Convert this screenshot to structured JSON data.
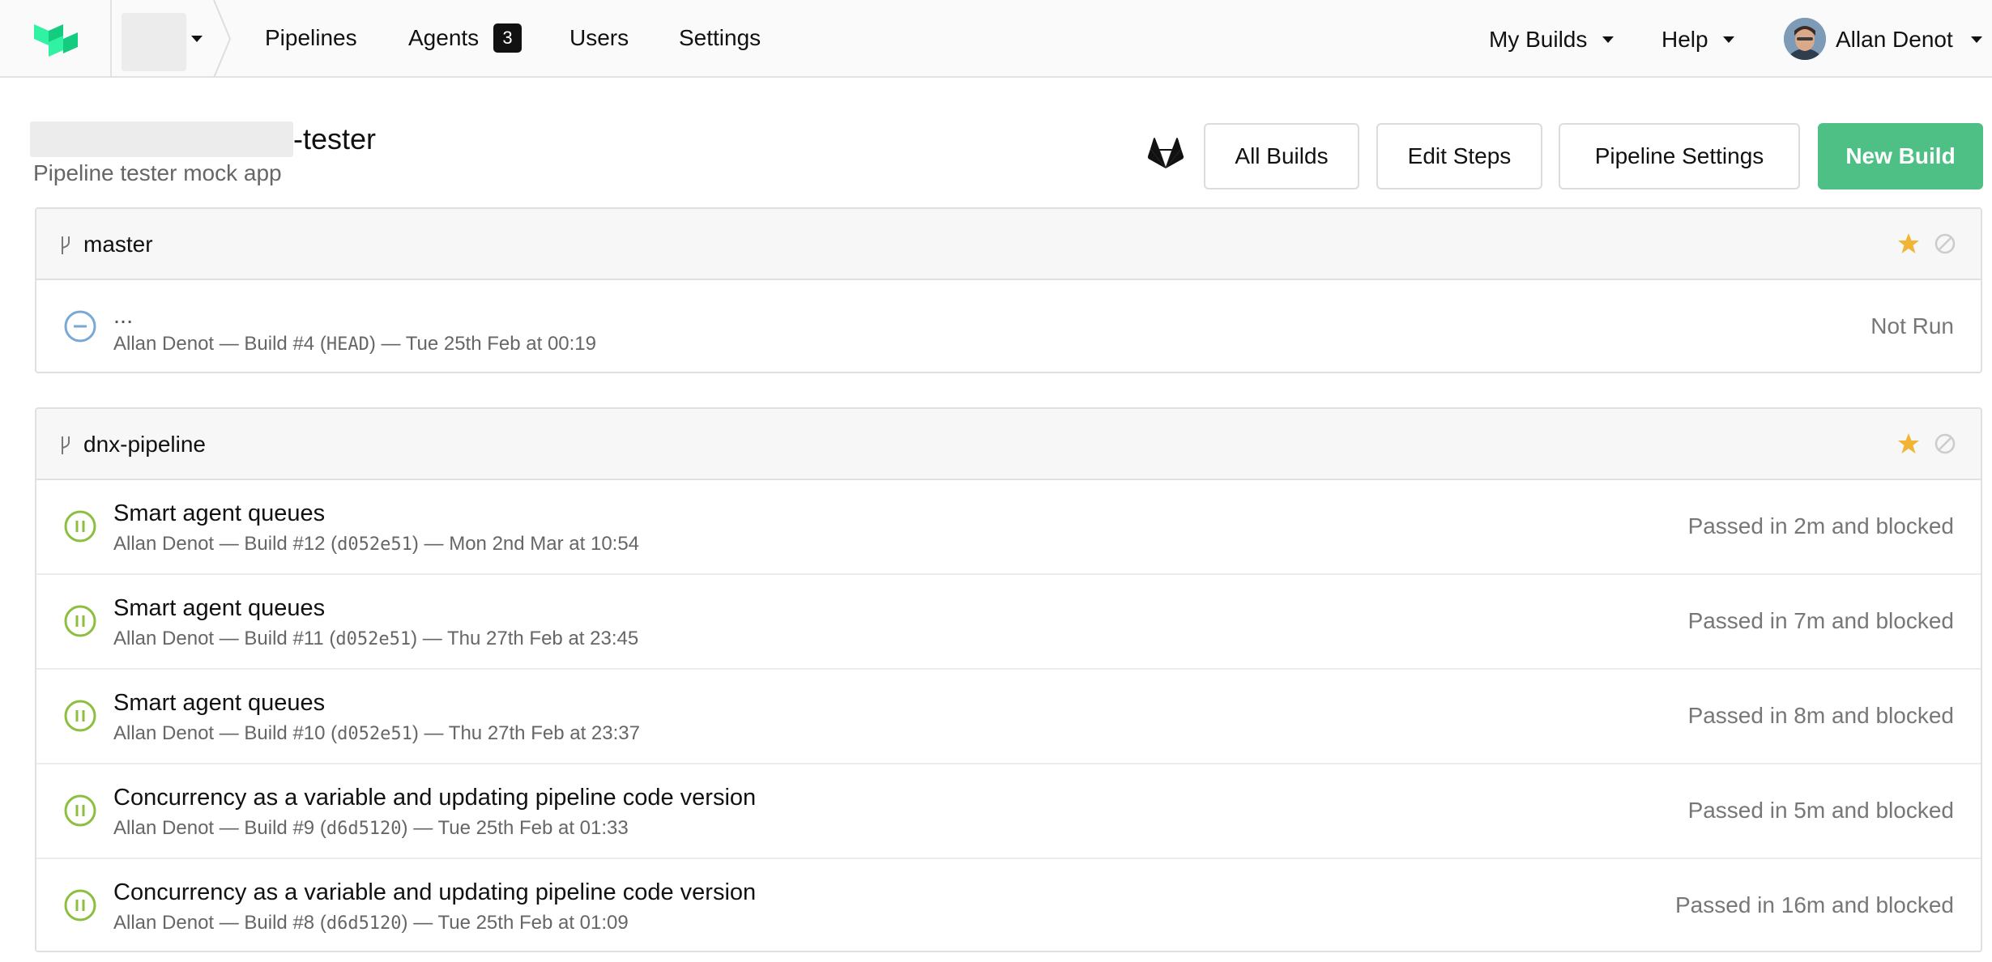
{
  "nav": {
    "links": {
      "pipelines": "Pipelines",
      "agents": "Agents",
      "users": "Users",
      "settings": "Settings"
    },
    "agents_count": "3",
    "my_builds": "My Builds",
    "help": "Help",
    "user_name": "Allan Denot"
  },
  "pipeline": {
    "title_suffix": "-tester",
    "description": "Pipeline tester mock app"
  },
  "actions": {
    "all_builds": "All Builds",
    "edit_steps": "Edit Steps",
    "pipeline_settings": "Pipeline Settings",
    "new_build": "New Build"
  },
  "colors": {
    "new_build_green": "#4fc085",
    "passed_blocked_green": "#8cbf3f",
    "not_run_blue": "#78a9d6",
    "star_gold": "#f1b434"
  },
  "branches": [
    {
      "name": "master",
      "builds": [
        {
          "status": "not-run",
          "title": "...",
          "author": "Allan Denot",
          "number": "#4",
          "commit": "HEAD",
          "date": "Tue 25th Feb at 00:19",
          "result": "Not Run"
        }
      ]
    },
    {
      "name": "dnx-pipeline",
      "builds": [
        {
          "status": "passed-blocked",
          "title": "Smart agent queues",
          "author": "Allan Denot",
          "number": "#12",
          "commit": "d052e51",
          "date": "Mon 2nd Mar at 10:54",
          "result": "Passed in 2m and blocked"
        },
        {
          "status": "passed-blocked",
          "title": "Smart agent queues",
          "author": "Allan Denot",
          "number": "#11",
          "commit": "d052e51",
          "date": "Thu 27th Feb at 23:45",
          "result": "Passed in 7m and blocked"
        },
        {
          "status": "passed-blocked",
          "title": "Smart agent queues",
          "author": "Allan Denot",
          "number": "#10",
          "commit": "d052e51",
          "date": "Thu 27th Feb at 23:37",
          "result": "Passed in 8m and blocked"
        },
        {
          "status": "passed-blocked",
          "title": "Concurrency as a variable and updating pipeline code version",
          "author": "Allan Denot",
          "number": "#9",
          "commit": "d6d5120",
          "date": "Tue 25th Feb at 01:33",
          "result": "Passed in 5m and blocked"
        },
        {
          "status": "passed-blocked",
          "title": "Concurrency as a variable and updating pipeline code version",
          "author": "Allan Denot",
          "number": "#8",
          "commit": "d6d5120",
          "date": "Tue 25th Feb at 01:09",
          "result": "Passed in 16m and blocked"
        }
      ]
    }
  ]
}
